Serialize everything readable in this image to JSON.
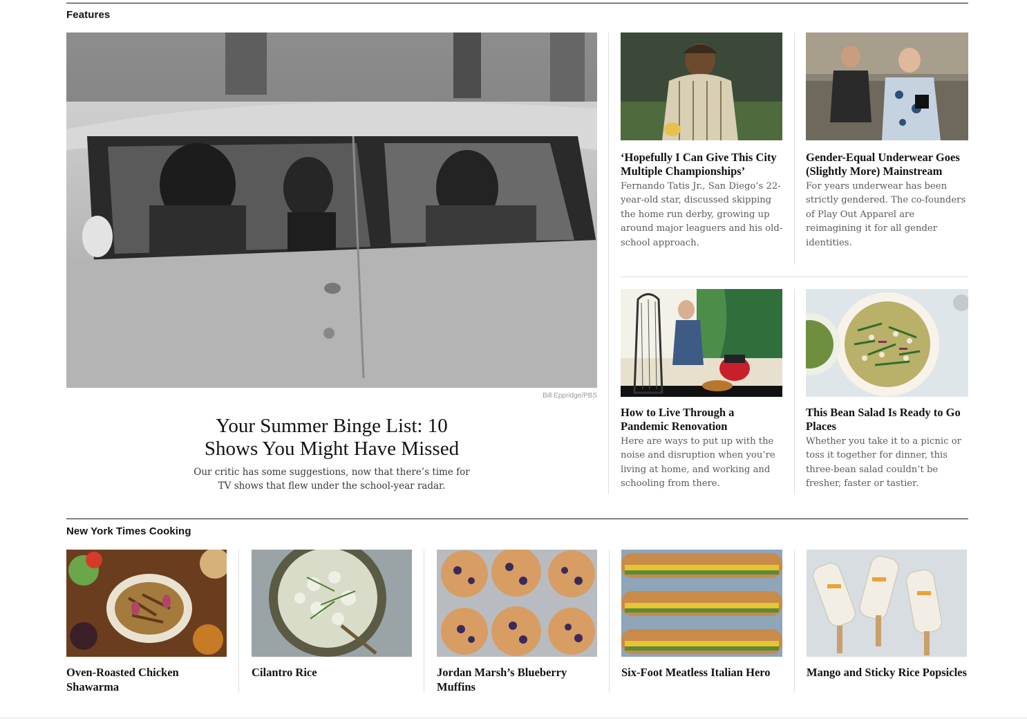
{
  "features": {
    "section_label": "Features",
    "lead": {
      "image_credit": "Bill Eppridge/PBS",
      "headline": "Your Summer Binge List: 10 Shows You Might Have Missed",
      "summary": "Our critic has some suggestions, now that there’s time for TV shows that flew under the school-year radar."
    },
    "cards": [
      {
        "headline": "‘Hopefully I Can Give This City Multiple Championships’",
        "summary": "Fernando Tatis Jr., San Diego’s 22-year-old star, discussed skipping the home run derby, growing up around major leaguers and his old-school approach."
      },
      {
        "headline": "Gender-Equal Underwear Goes (Slightly More) Mainstream",
        "summary": "For years underwear has been strictly gendered. The co-founders of Play Out Apparel are reimagining it for all gender identities."
      },
      {
        "headline": "How to Live Through a Pandemic Renovation",
        "summary": "Here are ways to put up with the noise and disruption when you’re living at home, and working and schooling from there."
      },
      {
        "headline": "This Bean Salad Is Ready to Go Places",
        "summary": "Whether you take it to a picnic or toss it together for dinner, this three-bean salad couldn’t be fresher, faster or tastier."
      }
    ]
  },
  "cooking": {
    "section_label": "New York Times Cooking",
    "recipes": [
      {
        "title": "Oven-Roasted Chicken Shawarma"
      },
      {
        "title": "Cilantro Rice"
      },
      {
        "title": "Jordan Marsh’s Blueberry Muffins"
      },
      {
        "title": "Six-Foot Meatless Italian Hero"
      },
      {
        "title": "Mango and Sticky Rice Popsicles"
      }
    ]
  },
  "colors": {
    "text": "#121212",
    "summary": "#5a5a5a",
    "rule": "#dfdfdf"
  }
}
